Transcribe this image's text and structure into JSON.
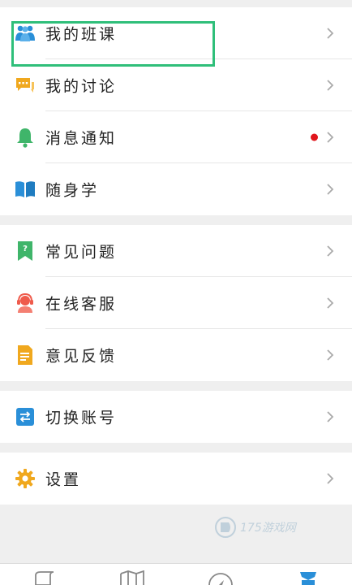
{
  "menu": {
    "group1": [
      {
        "label": "我的班课",
        "icon": "class-people-icon"
      },
      {
        "label": "我的讨论",
        "icon": "discussion-chat-icon"
      },
      {
        "label": "消息通知",
        "icon": "bell-icon",
        "badge_dot": true
      },
      {
        "label": "随身学",
        "icon": "book-icon"
      }
    ],
    "group2": [
      {
        "label": "常见问题",
        "icon": "faq-bookmark-icon"
      },
      {
        "label": "在线客服",
        "icon": "support-agent-icon"
      },
      {
        "label": "意见反馈",
        "icon": "feedback-document-icon"
      }
    ],
    "group3": [
      {
        "label": "切换账号",
        "icon": "switch-account-icon"
      }
    ],
    "group4": [
      {
        "label": "设置",
        "icon": "gear-icon"
      }
    ]
  },
  "watermark": {
    "text": "175游戏网"
  },
  "colors": {
    "highlight": "#2fbf7a",
    "notification_dot": "#e0161c",
    "icon_blue": "#2a8fd8",
    "icon_orange": "#f0a81e",
    "icon_green": "#3fb56a",
    "icon_red": "#ef5b4c"
  },
  "tabbar": {
    "tabs": [
      "resources-tab-icon",
      "map-tab-icon",
      "discover-tab-icon",
      "me-tab-icon"
    ]
  }
}
